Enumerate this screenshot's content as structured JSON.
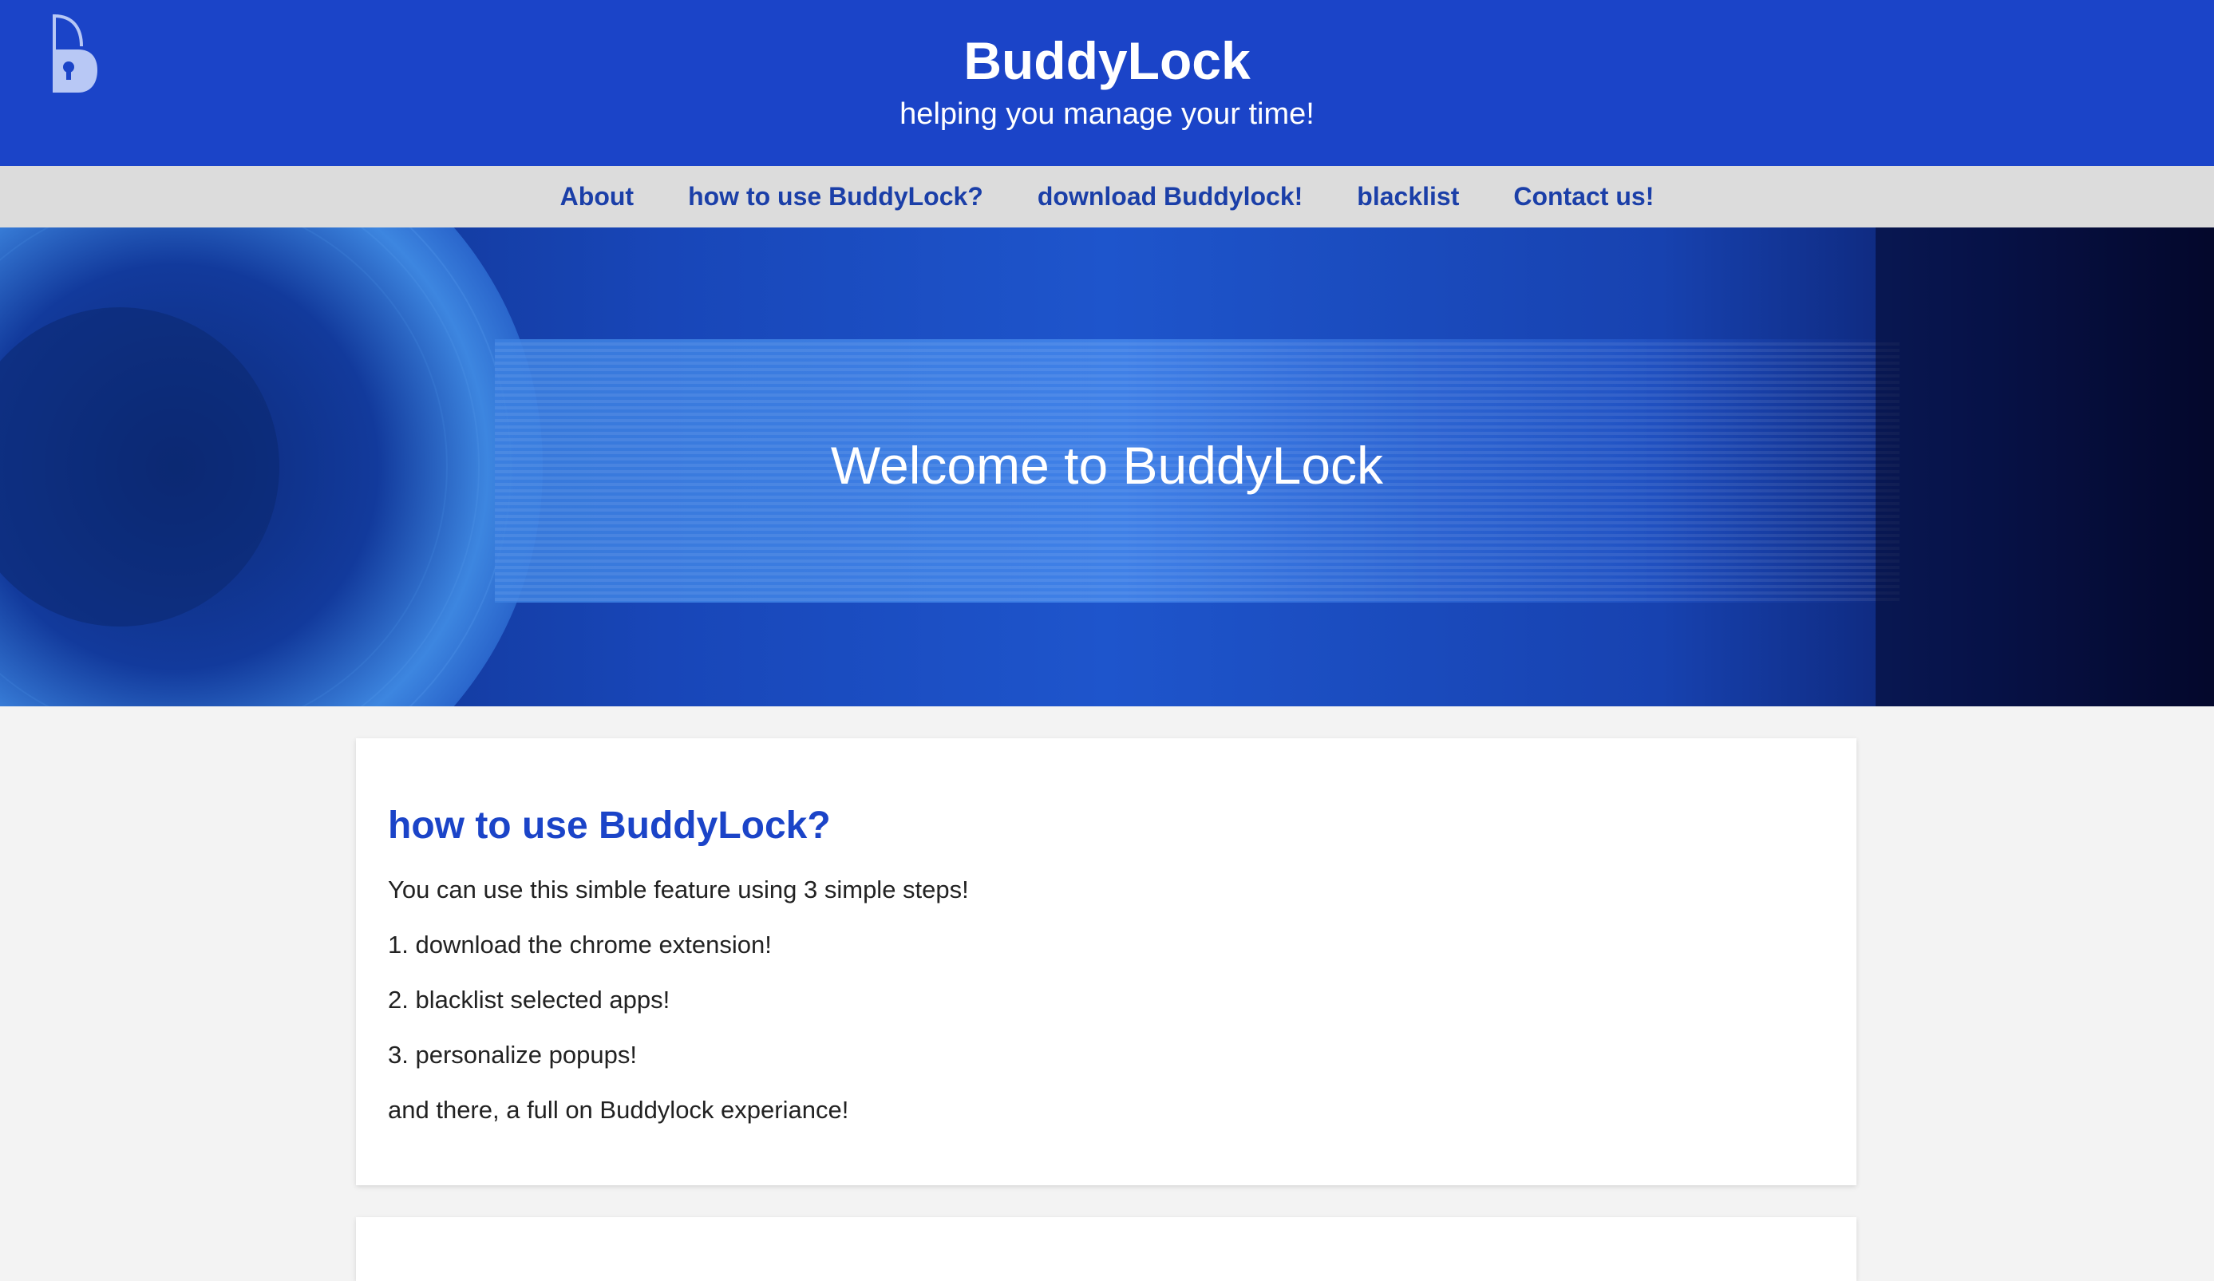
{
  "header": {
    "title": "BuddyLock",
    "tagline": "helping you manage your time!",
    "logo_icon": "buddylock-padlock-logo"
  },
  "nav": {
    "items": [
      {
        "label": "About"
      },
      {
        "label": "how to use BuddyLock?"
      },
      {
        "label": "download Buddylock!"
      },
      {
        "label": "blacklist"
      },
      {
        "label": "Contact us!"
      }
    ]
  },
  "hero": {
    "title": "Welcome to BuddyLock"
  },
  "section_how": {
    "title": "how to use BuddyLock?",
    "intro": "You can use this simble feature using 3 simple steps!",
    "steps": [
      "1. download the chrome extension!",
      "2. blacklist selected apps!",
      "3. personalize popups!"
    ],
    "outro": "and there, a full on Buddylock experiance!"
  },
  "colors": {
    "brand_blue": "#1b44c8",
    "nav_bg": "#dcdcdc",
    "nav_link": "#1b3fa8",
    "page_bg": "#f3f3f3"
  }
}
